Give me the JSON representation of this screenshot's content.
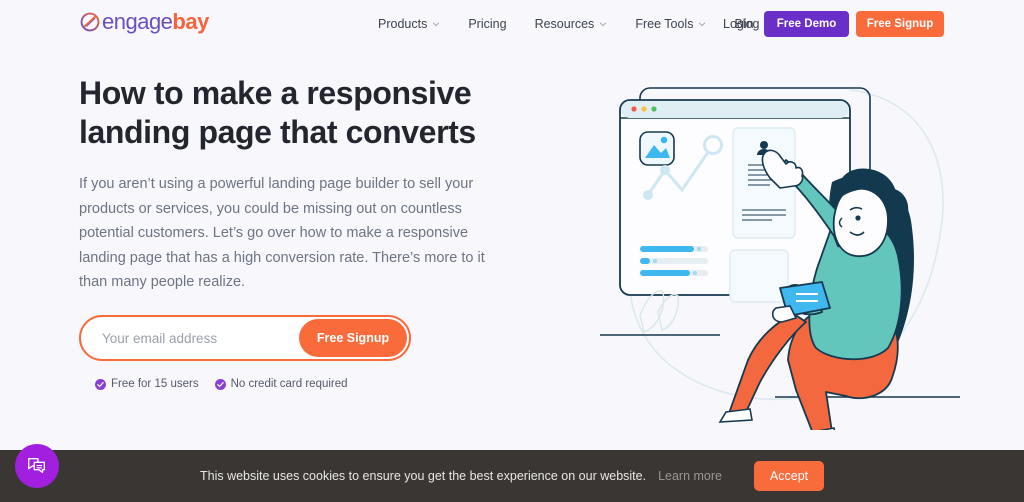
{
  "brand": {
    "name_part_a": "engage",
    "name_part_b": "bay",
    "logo_icon": "circle-check-logo-icon",
    "accent_purple": "#6b2fc9",
    "accent_orange": "#fa6b3c",
    "logo_purple": "#6a4fc1",
    "page_background": "#f7f7fc"
  },
  "nav": {
    "items": [
      {
        "label": "Products",
        "has_dropdown": true
      },
      {
        "label": "Pricing",
        "has_dropdown": false
      },
      {
        "label": "Resources",
        "has_dropdown": true
      },
      {
        "label": "Free Tools",
        "has_dropdown": true
      },
      {
        "label": "Blog",
        "has_dropdown": false
      }
    ],
    "login_label": "Login",
    "demo_button_label": "Free Demo",
    "signup_button_label": "Free Signup"
  },
  "hero": {
    "title": "How to make a responsive landing page that converts",
    "paragraph": "If you aren’t using a powerful landing page builder to sell your products or services, you could be missing out on countless potential customers. Let’s go over how to make a responsive landing page that has a high conversion rate. There’s more to it than many people realize.",
    "email_placeholder": "Your email address",
    "email_value": "",
    "signup_button_label": "Free Signup",
    "perks": [
      {
        "icon": "check-badge-icon",
        "label": "Free for 15 users"
      },
      {
        "icon": "check-badge-icon",
        "label": "No credit card required"
      }
    ],
    "illustration": {
      "name": "woman-pointing-at-browser-illustration",
      "browser_dots": [
        "#f05a4f",
        "#f5c045",
        "#4cc35c"
      ],
      "elements": [
        "browser-window",
        "image-placeholder-icon",
        "line-chart",
        "document-card",
        "progress-bars",
        "woman-figure",
        "tablet-device"
      ],
      "colors": {
        "teal": "#63c6bd",
        "orange": "#f4683f",
        "navy": "#13394f",
        "blue": "#3fb8f0",
        "light_blue": "#c9e6f5"
      }
    }
  },
  "chat": {
    "icon": "chat-bubble-icon",
    "color": "#a21fe0"
  },
  "cookie_banner": {
    "message": "This website uses cookies to ensure you get the best experience on our website.",
    "link_label": "Learn more",
    "accept_label": "Accept"
  }
}
